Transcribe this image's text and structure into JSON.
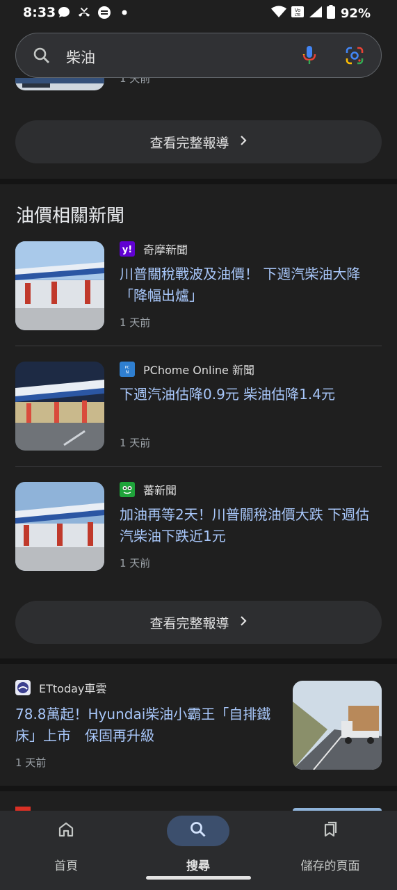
{
  "status_bar": {
    "time": "8:33",
    "battery": "92%",
    "network": "VoLTE"
  },
  "search": {
    "query": "柴油"
  },
  "top_card": {
    "partial_time": "1 天前",
    "full_coverage_label": "查看完整報導"
  },
  "oil_news": {
    "title": "油價相關新聞",
    "articles": [
      {
        "source": "奇摩新聞",
        "headline": "川普關稅戰波及油價！ 下週汽柴油大降「降幅出爐」",
        "time": "1 天前"
      },
      {
        "source": "PChome Online 新聞",
        "headline": "下週汽油估降0.9元 柴油估降1.4元",
        "time": "1 天前"
      },
      {
        "source": "蕃新聞",
        "headline": "加油再等2天！川普關稅油價大跌 下週估汽柴油下跌近1元",
        "time": "1 天前"
      }
    ],
    "full_coverage_label": "查看完整報導"
  },
  "ettoday_card": {
    "source": "ETtoday車雲",
    "headline": "78.8萬起！Hyundai柴油小霸王「自排鐵床」上市　保固再升級",
    "time": "1 天前"
  },
  "bottom_nav": {
    "items": [
      {
        "label": "首頁",
        "icon": "home-icon"
      },
      {
        "label": "搜尋",
        "icon": "search-icon",
        "active": true
      },
      {
        "label": "儲存的頁面",
        "icon": "bookmarks-icon"
      }
    ]
  },
  "colors": {
    "background": "#1f1f1f",
    "headline_link": "#a8c7fa",
    "active_nav_pill": "#3c4f6d"
  }
}
